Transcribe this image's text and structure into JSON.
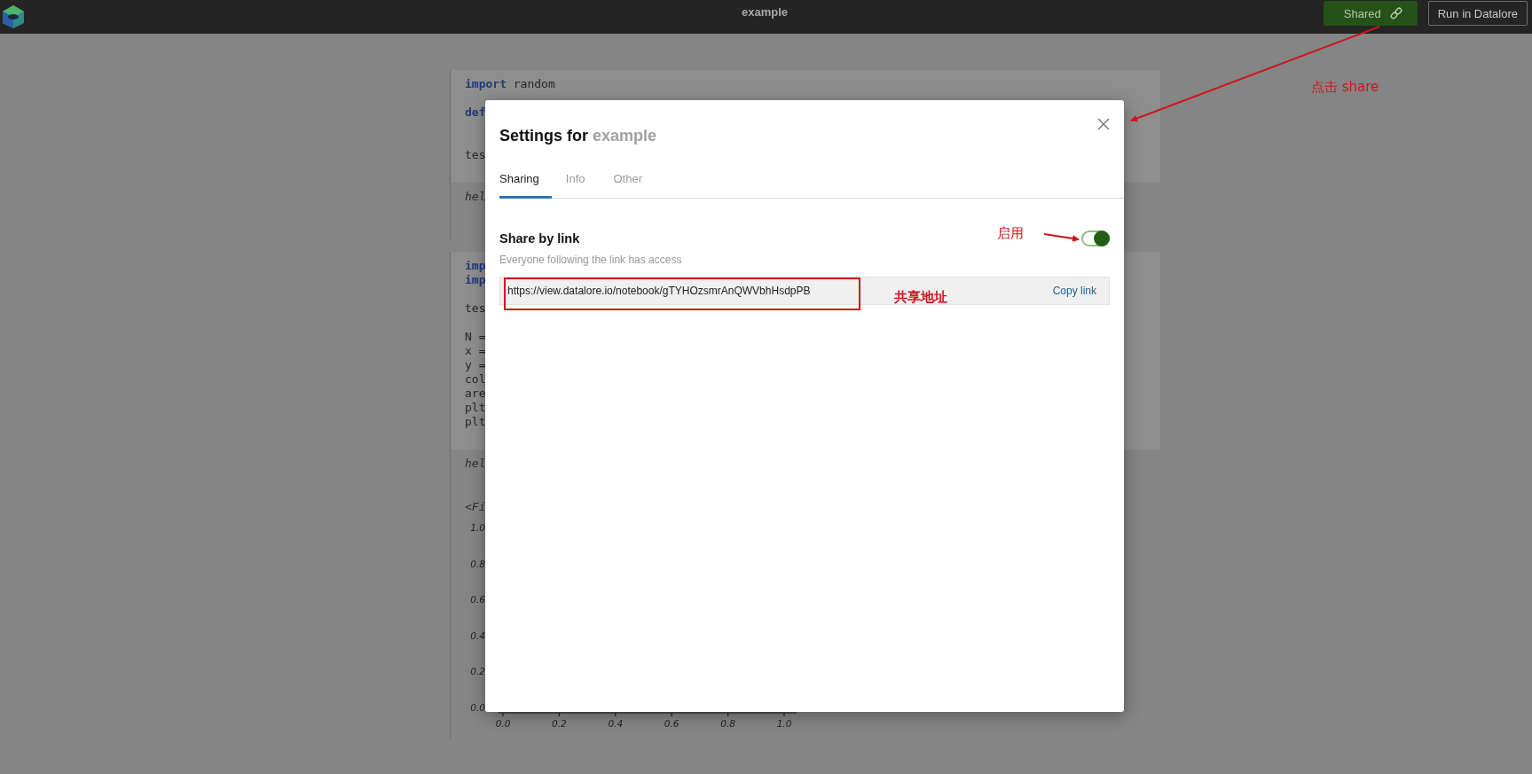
{
  "top_bar": {
    "title": "example",
    "buttons": [
      {
        "label": "Shared",
        "kind": "primary"
      },
      {
        "label": "Run in Datalore",
        "kind": "outline"
      }
    ]
  },
  "notebook": {
    "cells": [
      {
        "code": [
          [
            [
              {
                "t": "import",
                "kind": "keyword"
              },
              {
                "t": " random",
                "kind": "plain"
              }
            ]
          ],
          [
            [
              {
                "t": "def",
                "kind": "keyword"
              }
            ]
          ],
          [
            [
              {
                "t": "tes",
                "kind": "plain"
              }
            ]
          ]
        ],
        "output": [
          "hel"
        ]
      },
      {
        "code": [
          [
            [
              {
                "t": "imp",
                "kind": "keyword"
              }
            ],
            [
              {
                "t": "imp",
                "kind": "keyword"
              }
            ]
          ],
          [
            [
              {
                "t": "tes",
                "kind": "plain"
              }
            ]
          ],
          [
            [
              {
                "t": "N =",
                "kind": "plain"
              }
            ],
            [
              {
                "t": "x =",
                "kind": "plain"
              }
            ],
            [
              {
                "t": "y =",
                "kind": "plain"
              }
            ],
            [
              {
                "t": "col",
                "kind": "plain"
              }
            ],
            [
              {
                "t": "are",
                "kind": "plain"
              }
            ],
            [
              {
                "t": "plt",
                "kind": "plain"
              }
            ],
            [
              {
                "t": "plt",
                "kind": "plain"
              }
            ]
          ]
        ],
        "output": [
          "hel",
          "<Fi"
        ],
        "figure": {
          "y_ticks": [
            "1.0",
            "0.8",
            "0.6",
            "0.4",
            "0.2",
            "0.0"
          ],
          "x_ticks": [
            "0.0",
            "0.2",
            "0.4",
            "0.6",
            "0.8",
            "1.0"
          ]
        }
      }
    ]
  },
  "dialog": {
    "title": "Settings for",
    "title_name": "example",
    "tabs": [
      {
        "label": "Sharing",
        "selected": true
      },
      {
        "label": "Info",
        "selected": false
      },
      {
        "label": "Other",
        "selected": false
      }
    ],
    "share": {
      "heading": "Share by link",
      "on": true,
      "description": "Everyone following the link has access",
      "link": "https://view.datalore.io/notebook/gTYHOzsmrAnQWVbhHsdpPB",
      "copy_label": "Copy link"
    }
  },
  "annotations": [
    {
      "text": "点击 share"
    },
    {
      "text": "启用"
    },
    {
      "text": "共享地址"
    }
  ]
}
